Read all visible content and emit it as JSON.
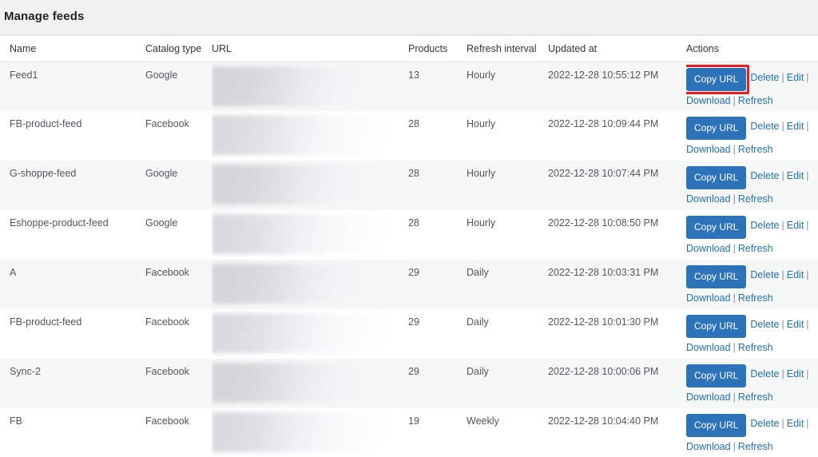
{
  "page": {
    "title": "Manage feeds",
    "background": "#f1f1f1",
    "accent_blue": "#2d73ba",
    "link_blue": "#2271b1",
    "highlight_red": "#ee1c1c"
  },
  "table": {
    "columns": [
      {
        "key": "name",
        "label": "Name"
      },
      {
        "key": "catalog",
        "label": "Catalog type"
      },
      {
        "key": "url",
        "label": "URL"
      },
      {
        "key": "products",
        "label": "Products"
      },
      {
        "key": "refresh",
        "label": "Refresh interval"
      },
      {
        "key": "updated",
        "label": "Updated at"
      },
      {
        "key": "actions",
        "label": "Actions"
      }
    ],
    "actions": {
      "copy_url": "Copy URL",
      "delete": "Delete",
      "edit": "Edit",
      "download": "Download",
      "refresh": "Refresh",
      "separator": "|"
    },
    "url_value": "",
    "rows": [
      {
        "name": "Feed1",
        "catalog": "Google",
        "url": "",
        "products": "13",
        "refresh": "Hourly",
        "updated": "2022-12-28 10:55:12 PM",
        "copy_url_highlighted": true
      },
      {
        "name": "FB-product-feed",
        "catalog": "Facebook",
        "url": "",
        "products": "28",
        "refresh": "Hourly",
        "updated": "2022-12-28 10:09:44 PM",
        "copy_url_highlighted": false
      },
      {
        "name": "G-shoppe-feed",
        "catalog": "Google",
        "url": "",
        "products": "28",
        "refresh": "Hourly",
        "updated": "2022-12-28 10:07:44 PM",
        "copy_url_highlighted": false
      },
      {
        "name": "Eshoppe-product-feed",
        "catalog": "Google",
        "url": "",
        "products": "28",
        "refresh": "Hourly",
        "updated": "2022-12-28 10:08:50 PM",
        "copy_url_highlighted": false
      },
      {
        "name": "A",
        "catalog": "Facebook",
        "url": "",
        "products": "29",
        "refresh": "Daily",
        "updated": "2022-12-28 10:03:31 PM",
        "copy_url_highlighted": false
      },
      {
        "name": "FB-product-feed",
        "catalog": "Facebook",
        "url": "",
        "products": "29",
        "refresh": "Daily",
        "updated": "2022-12-28 10:01:30 PM",
        "copy_url_highlighted": false
      },
      {
        "name": "Sync-2",
        "catalog": "Facebook",
        "url": "",
        "products": "29",
        "refresh": "Daily",
        "updated": "2022-12-28 10:00:06 PM",
        "copy_url_highlighted": false
      },
      {
        "name": "FB",
        "catalog": "Facebook",
        "url": "",
        "products": "19",
        "refresh": "Weekly",
        "updated": "2022-12-28 10:04:40 PM",
        "copy_url_highlighted": false
      }
    ]
  }
}
